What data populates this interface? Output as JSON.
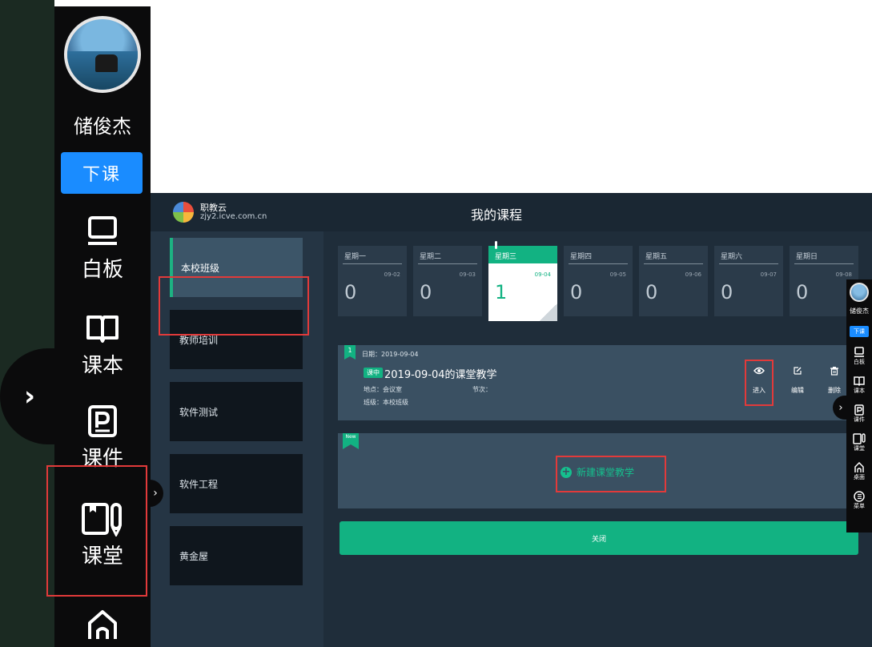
{
  "toolbar": {
    "user_name": "储俊杰",
    "end_class_label": "下课",
    "tools": [
      {
        "label": "白板",
        "icon": "whiteboard-icon"
      },
      {
        "label": "课本",
        "icon": "book-icon"
      },
      {
        "label": "课件",
        "icon": "courseware-icon"
      },
      {
        "label": "课堂",
        "icon": "classroom-icon"
      },
      {
        "label": "",
        "icon": "home-icon"
      }
    ],
    "expand_glyph": "›"
  },
  "app": {
    "logo_name": "职教云",
    "logo_url": "zjy2.icve.com.cn",
    "title": "我的课程"
  },
  "sidebar": {
    "items": [
      {
        "label": "本校班级",
        "active": true
      },
      {
        "label": "教师培训",
        "active": false
      },
      {
        "label": "软件测试",
        "active": false
      },
      {
        "label": "软件工程",
        "active": false
      },
      {
        "label": "黄金屋",
        "active": false
      }
    ],
    "collapse_glyph": "›"
  },
  "week": [
    {
      "name": "星期一",
      "date": "09-02",
      "count": "0",
      "active": false
    },
    {
      "name": "星期二",
      "date": "09-03",
      "count": "0",
      "active": false
    },
    {
      "name": "星期三",
      "date": "09-04",
      "count": "1",
      "active": true
    },
    {
      "name": "星期四",
      "date": "09-05",
      "count": "0",
      "active": false
    },
    {
      "name": "星期五",
      "date": "09-06",
      "count": "0",
      "active": false
    },
    {
      "name": "星期六",
      "date": "09-07",
      "count": "0",
      "active": false
    },
    {
      "name": "星期日",
      "date": "09-08",
      "count": "0",
      "active": false
    }
  ],
  "lesson": {
    "flag_number": "1",
    "date_text": "日期：2019-09-04",
    "badge": "课中",
    "title": "2019-09-04的课堂教学",
    "location": "地点：会议室",
    "period": "节次：",
    "class_name": "班级：本校班级",
    "actions": {
      "enter": "进入",
      "edit": "编辑",
      "delete": "删除"
    }
  },
  "new_card": {
    "flag": "New",
    "button_label": "新建课堂教学"
  },
  "close_label": "关闭",
  "mini_toolbar": {
    "user_name": "储俊杰",
    "end_class_label": "下课",
    "tools": [
      {
        "label": "白板"
      },
      {
        "label": "课本"
      },
      {
        "label": "课件"
      },
      {
        "label": "课堂"
      },
      {
        "label": "桌面"
      },
      {
        "label": "菜单"
      }
    ],
    "expand_glyph": "›"
  },
  "colors": {
    "accent_green": "#12b282",
    "accent_blue": "#1a8cff",
    "highlight_red": "#e23a3a"
  }
}
